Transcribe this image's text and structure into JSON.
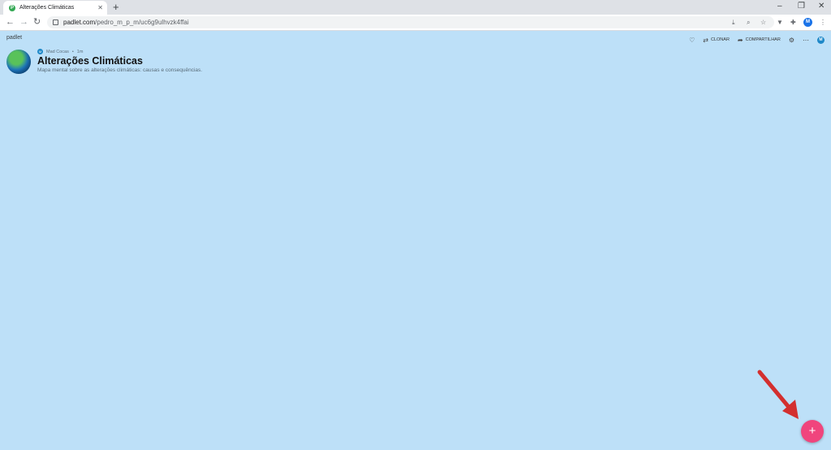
{
  "browser": {
    "tab_title": "Alterações Climáticas",
    "favicon_letter": "P",
    "new_tab": "+",
    "close_tab": "✕",
    "url_host": "padlet.com",
    "url_path": "/pedro_m_p_m/uc6g9ulhvzk4ffai",
    "profile_initial": "M",
    "window_controls": {
      "minimize": "–",
      "restore": "❐",
      "close": "✕"
    }
  },
  "padlet": {
    "logo": "padlet",
    "actions": {
      "like_icon": "♡",
      "clone_label": "CLONAR",
      "share_label": "COMPARTILHAR",
      "settings_icon": "⚙",
      "more_icon": "⋯",
      "user_initial": "M"
    },
    "wall": {
      "author_initial": "M",
      "author_name": "Mad Cocas",
      "separator": "•",
      "time": "1m",
      "title": "Alterações Climáticas",
      "subtitle": "Mapa mental sobre as alterações climáticas: causas e consequências."
    },
    "fab_label": "+"
  },
  "colors": {
    "background": "#bde0f8",
    "fab": "#f0457d",
    "arrow": "#d32f2f"
  }
}
